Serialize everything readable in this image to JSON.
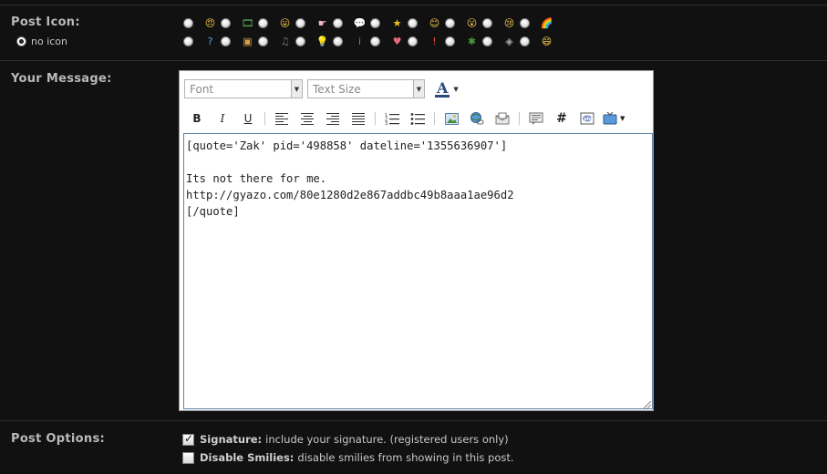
{
  "post_icon": {
    "label": "Post Icon:",
    "no_icon_label": "no icon",
    "row1": [
      {
        "name": "angry-face-icon",
        "glyph": "😠",
        "color": "#f3c64a"
      },
      {
        "name": "film-icon",
        "glyph": "🎞",
        "color": "#5aa25a"
      },
      {
        "name": "tongue-face-icon",
        "glyph": "😛",
        "color": "#f3c64a"
      },
      {
        "name": "hand-pointer-icon",
        "glyph": "☛",
        "color": "#f0b8c8"
      },
      {
        "name": "speech-bubble-icon",
        "glyph": "💬",
        "color": "#f0b8c8"
      },
      {
        "name": "star-icon",
        "glyph": "★",
        "color": "#f2c21b"
      },
      {
        "name": "smile-face-icon",
        "glyph": "😊",
        "color": "#f3c64a"
      },
      {
        "name": "shocked-face-icon",
        "glyph": "😮",
        "color": "#f3c64a"
      },
      {
        "name": "sad-face-icon",
        "glyph": "😢",
        "color": "#f3c64a"
      },
      {
        "name": "rainbow-icon",
        "glyph": "🌈",
        "color": "#e85a4a"
      }
    ],
    "row2": [
      {
        "name": "question-icon",
        "glyph": "?",
        "color": "#6aa0d8"
      },
      {
        "name": "picture-icon",
        "glyph": "▣",
        "color": "#d8a048"
      },
      {
        "name": "music-note-icon",
        "glyph": "♫",
        "color": "#777777"
      },
      {
        "name": "lightbulb-icon",
        "glyph": "💡",
        "color": "#f0e060"
      },
      {
        "name": "info-icon",
        "glyph": "i",
        "color": "#4a86c8"
      },
      {
        "name": "heart-icon",
        "glyph": "♥",
        "color": "#e86a7a"
      },
      {
        "name": "exclamation-icon",
        "glyph": "!",
        "color": "#e04a3a"
      },
      {
        "name": "bug-icon",
        "glyph": "✱",
        "color": "#4a9a3a"
      },
      {
        "name": "cube-icon",
        "glyph": "◈",
        "color": "#aaaaaa"
      },
      {
        "name": "laugh-face-icon",
        "glyph": "😄",
        "color": "#f3c64a"
      }
    ]
  },
  "message": {
    "label": "Your Message:",
    "font_placeholder": "Font",
    "size_placeholder": "Text Size",
    "text": "[quote='Zak' pid='498858' dateline='1355636907']\n\nIts not there for me.\nhttp://gyazo.com/80e1280d2e867addbc49b8aaa1ae96d2\n[/quote]"
  },
  "toolbar": {
    "bold": "B",
    "italic": "I",
    "underline": "U",
    "code": "#"
  },
  "options": {
    "label": "Post Options:",
    "signature_title": "Signature:",
    "signature_desc": "include your signature. (registered users only)",
    "signature_checked": true,
    "smilies_title": "Disable Smilies:",
    "smilies_desc": "disable smilies from showing in this post.",
    "smilies_checked": false
  }
}
